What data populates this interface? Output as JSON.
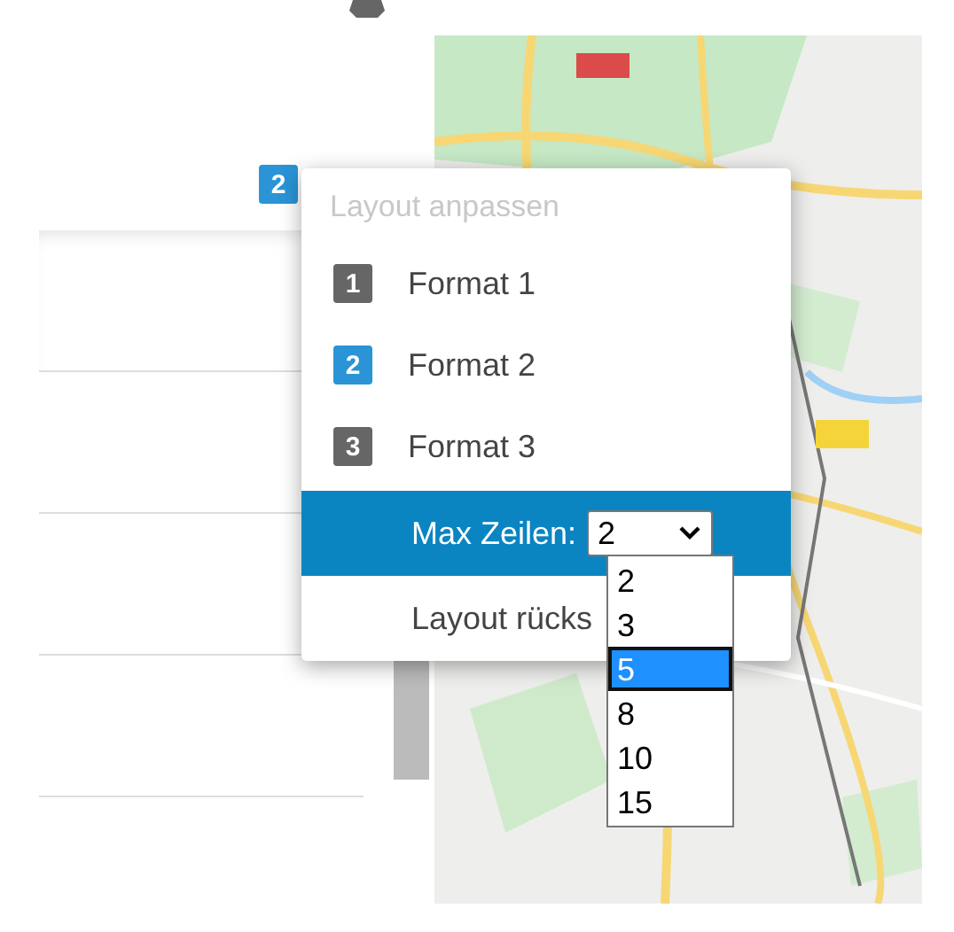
{
  "layout_badge": "2",
  "menu": {
    "title": "Layout anpassen",
    "formats": [
      {
        "number": "1",
        "label": "Format 1",
        "selected": false
      },
      {
        "number": "2",
        "label": "Format 2",
        "selected": true
      },
      {
        "number": "3",
        "label": "Format 3",
        "selected": false
      }
    ],
    "max_rows": {
      "label": "Max Zeilen:",
      "value": "2",
      "expanded": true,
      "options": [
        {
          "label": "2",
          "highlighted": false
        },
        {
          "label": "3",
          "highlighted": false
        },
        {
          "label": "5",
          "highlighted": true
        },
        {
          "label": "8",
          "highlighted": false
        },
        {
          "label": "10",
          "highlighted": false
        },
        {
          "label": "15",
          "highlighted": false
        }
      ]
    },
    "reset": "Layout rücks"
  }
}
